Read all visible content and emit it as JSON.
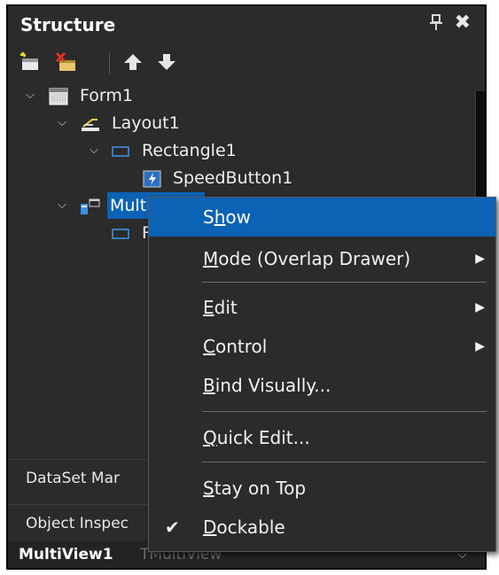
{
  "panel": {
    "title": "Structure",
    "pin_icon": "pin-icon",
    "close_icon": "close-icon"
  },
  "toolbar": {
    "buttons": [
      {
        "name": "new-item-icon"
      },
      {
        "name": "delete-item-icon"
      },
      {
        "name": "move-up-icon"
      },
      {
        "name": "move-down-icon"
      }
    ]
  },
  "tree": {
    "nodes": [
      {
        "label": "Form1",
        "expanded": true,
        "level": 0
      },
      {
        "label": "Layout1",
        "expanded": true,
        "level": 1
      },
      {
        "label": "Rectangle1",
        "expanded": true,
        "level": 2
      },
      {
        "label": "SpeedButton1",
        "level": 3
      },
      {
        "label": "MultiView1",
        "expanded": true,
        "level": 1,
        "selected": true
      },
      {
        "label": "R",
        "level": 2
      }
    ]
  },
  "tabs": {
    "dataset": "DataSet Mar",
    "inspector": "Object Inspec"
  },
  "status": {
    "name": "MultiView1",
    "type": "TMultiView"
  },
  "menu": {
    "items": [
      {
        "pre": "",
        "u": "S",
        "post": "how",
        "highlighted": true
      },
      {
        "pre": "",
        "u": "M",
        "post": "ode (Overlap Drawer)",
        "submenu": true
      },
      {
        "pre": "",
        "u": "E",
        "post": "dit",
        "submenu": true
      },
      {
        "pre": "",
        "u": "C",
        "post": "ontrol",
        "submenu": true
      },
      {
        "pre": "",
        "u": "B",
        "post": "ind Visually...",
        "submenu": false
      },
      {
        "pre": "",
        "u": "Q",
        "post": "uick Edit..."
      },
      {
        "pre": "",
        "u": "S",
        "post": "tay on Top"
      },
      {
        "pre": "",
        "u": "D",
        "post": "ockable",
        "checked": true
      }
    ],
    "show_pre": "S",
    "show_u": "h",
    "show_post": "ow",
    "arrow_glyph": "▶",
    "check_glyph": "✔"
  },
  "colors": {
    "panel_bg": "#2b2b2b",
    "selection": "#0c62b5",
    "text": "#f0f0f0"
  }
}
